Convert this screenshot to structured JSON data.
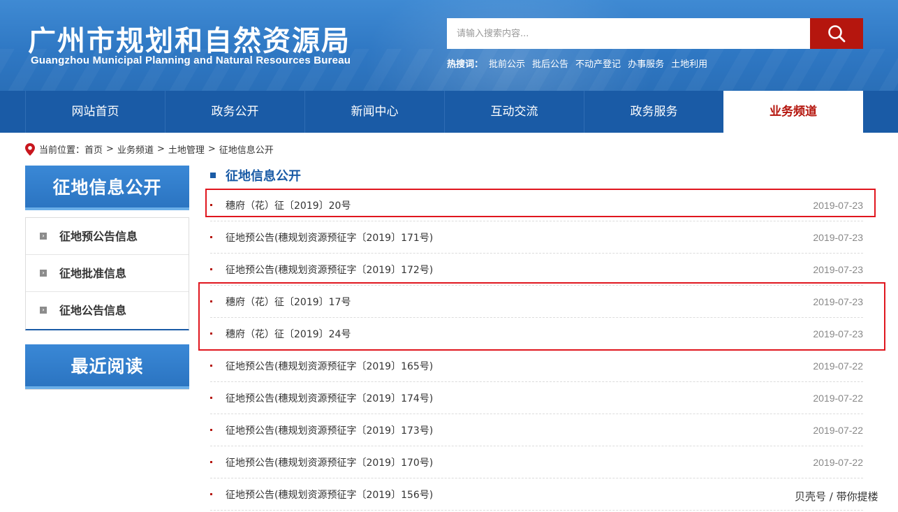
{
  "header": {
    "title_cn": "广州市规划和自然资源局",
    "title_en": "Guangzhou Municipal Planning and Natural Resources Bureau",
    "search_placeholder": "请输入搜索内容...",
    "hot_label": "热搜词：",
    "hot_words": [
      "批前公示",
      "批后公告",
      "不动产登记",
      "办事服务",
      "土地利用"
    ]
  },
  "nav": {
    "items": [
      "网站首页",
      "政务公开",
      "新闻中心",
      "互动交流",
      "政务服务",
      "业务频道"
    ],
    "active_index": 5
  },
  "breadcrumb": {
    "label": "当前位置：",
    "items": [
      "首页",
      "业务频道",
      "土地管理",
      "征地信息公开"
    ],
    "separator": ">"
  },
  "sidebar": {
    "header1": "征地信息公开",
    "items": [
      "征地预公告信息",
      "征地批准信息",
      "征地公告信息"
    ],
    "header2": "最近阅读"
  },
  "main": {
    "section_title": "征地信息公开",
    "rows": [
      {
        "title": "穗府（花）征〔2019〕20号",
        "date": "2019-07-23"
      },
      {
        "title": "征地预公告(穗规划资源预征字〔2019〕171号)",
        "date": "2019-07-23"
      },
      {
        "title": "征地预公告(穗规划资源预征字〔2019〕172号)",
        "date": "2019-07-23"
      },
      {
        "title": "穗府（花）征〔2019〕17号",
        "date": "2019-07-23"
      },
      {
        "title": "穗府（花）征〔2019〕24号",
        "date": "2019-07-23"
      },
      {
        "title": "征地预公告(穗规划资源预征字〔2019〕165号)",
        "date": "2019-07-22"
      },
      {
        "title": "征地预公告(穗规划资源预征字〔2019〕174号)",
        "date": "2019-07-22"
      },
      {
        "title": "征地预公告(穗规划资源预征字〔2019〕173号)",
        "date": "2019-07-22"
      },
      {
        "title": "征地预公告(穗规划资源预征字〔2019〕170号)",
        "date": "2019-07-22"
      },
      {
        "title": "征地预公告(穗规划资源预征字〔2019〕156号)",
        "date": ""
      }
    ]
  },
  "watermark": "贝壳号 / 带你提楼",
  "colors": {
    "brand_blue": "#1a5ba6",
    "accent_red": "#b5160e",
    "highlight_red": "#e0161e"
  }
}
